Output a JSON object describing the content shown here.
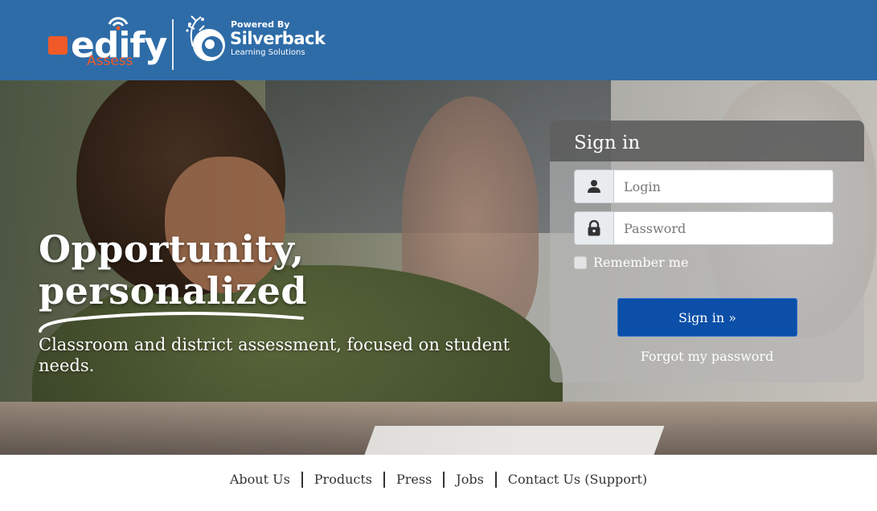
{
  "header": {
    "brand_name": "edify",
    "brand_sub": "Assess",
    "partner_powered": "Powered By",
    "partner_name": "Silverback",
    "partner_sub": "Learning Solutions",
    "colors": {
      "header_bg": "#2e6ca8",
      "brand_accent": "#ef5a28"
    }
  },
  "hero": {
    "headline_line1": "Opportunity,",
    "headline_line2": "personalized",
    "tagline": "Classroom and district assessment, focused on student needs."
  },
  "signin": {
    "title": "Sign in",
    "login_placeholder": "Login",
    "login_value": "",
    "password_placeholder": "Password",
    "password_value": "",
    "remember_label": "Remember me",
    "remember_checked": false,
    "submit_label": "Sign in »",
    "forgot_label": "Forgot my password",
    "icons": {
      "login": "user-icon",
      "password": "lock-icon"
    },
    "colors": {
      "submit_bg": "#0b4fa8"
    }
  },
  "footer": {
    "links": [
      "About Us",
      "Products",
      "Press",
      "Jobs",
      "Contact Us (Support)"
    ]
  }
}
